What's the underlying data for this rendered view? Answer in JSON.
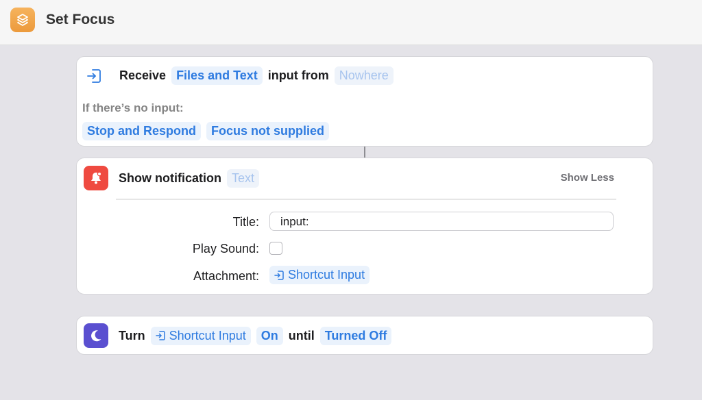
{
  "window": {
    "title": "Set Focus",
    "app_icon": "shortcuts-layers-icon"
  },
  "receive_action": {
    "receive_label": "Receive",
    "types_token": "Files and Text",
    "input_from_label": "input from",
    "source_token": "Nowhere",
    "no_input_label": "If there’s no input:",
    "fallback_action_token": "Stop and Respond",
    "fallback_message_token": "Focus not supplied",
    "icon": "receive-input-icon"
  },
  "notification_action": {
    "title": "Show notification",
    "text_token": "Text",
    "show_less_label": "Show Less",
    "icon": "bell-icon",
    "icon_color": "#ef4a40",
    "fields": {
      "title_label": "Title:",
      "title_value": "input:",
      "play_sound_label": "Play Sound:",
      "play_sound_checked": false,
      "attachment_label": "Attachment:",
      "attachment_token": "Shortcut Input"
    }
  },
  "focus_action": {
    "turn_label": "Turn",
    "focus_token": "Shortcut Input",
    "state_token": "On",
    "until_label": "until",
    "until_token": "Turned Off",
    "icon": "moon-icon",
    "icon_color": "#5a4fd0"
  },
  "colors": {
    "accent": "#2e7be0",
    "token_bg": "#eaf2fc",
    "background": "#e4e3e8"
  }
}
